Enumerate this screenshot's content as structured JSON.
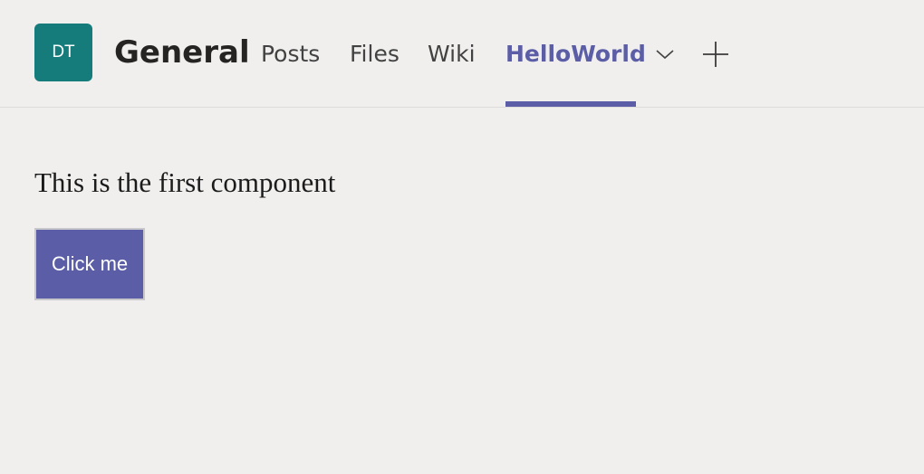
{
  "header": {
    "avatar_initials": "DT",
    "channel_title": "General",
    "tabs": [
      {
        "label": "Posts"
      },
      {
        "label": "Files"
      },
      {
        "label": "Wiki"
      },
      {
        "label": "HelloWorld",
        "active": true
      }
    ],
    "active_tab_icon": "chevron-down-icon",
    "add_tab_icon": "plus-icon"
  },
  "main": {
    "text": "This is the first component",
    "button_label": "Click me"
  },
  "colors": {
    "background": "#f0efee",
    "avatar": "#157b7b",
    "accent": "#5b5ea6",
    "text": "#252423"
  }
}
